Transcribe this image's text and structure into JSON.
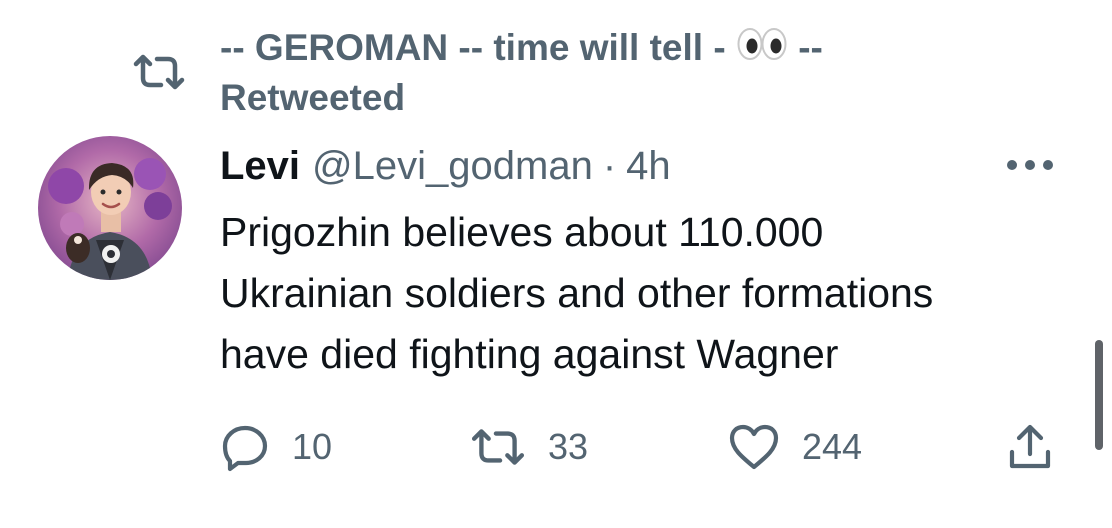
{
  "retweet_header": {
    "retweeter_name": "-- GEROMAN -- time will tell -",
    "retweeter_name_suffix": "--",
    "emoji_icon": "eyes-emoji",
    "label": "Retweeted",
    "icon": "retweet-icon"
  },
  "tweet": {
    "author": {
      "name": "Levi",
      "handle": "@Levi_godman",
      "separator": "·",
      "time": "4h",
      "avatar_icon": "avatar"
    },
    "more_icon": "more-options-icon",
    "text_lines": [
      "Prigozhin believes about 110.000",
      "Ukrainian soldiers and other formations",
      "have died fighting against Wagner"
    ],
    "actions": {
      "reply": {
        "icon": "reply-icon",
        "count": "10"
      },
      "retweet": {
        "icon": "retweet-icon",
        "count": "33"
      },
      "like": {
        "icon": "heart-icon",
        "count": "244"
      },
      "share": {
        "icon": "share-icon"
      }
    }
  },
  "colors": {
    "text_primary": "#0f1419",
    "text_secondary": "#536471",
    "background": "#ffffff",
    "scrollbar": "#5f6368"
  }
}
